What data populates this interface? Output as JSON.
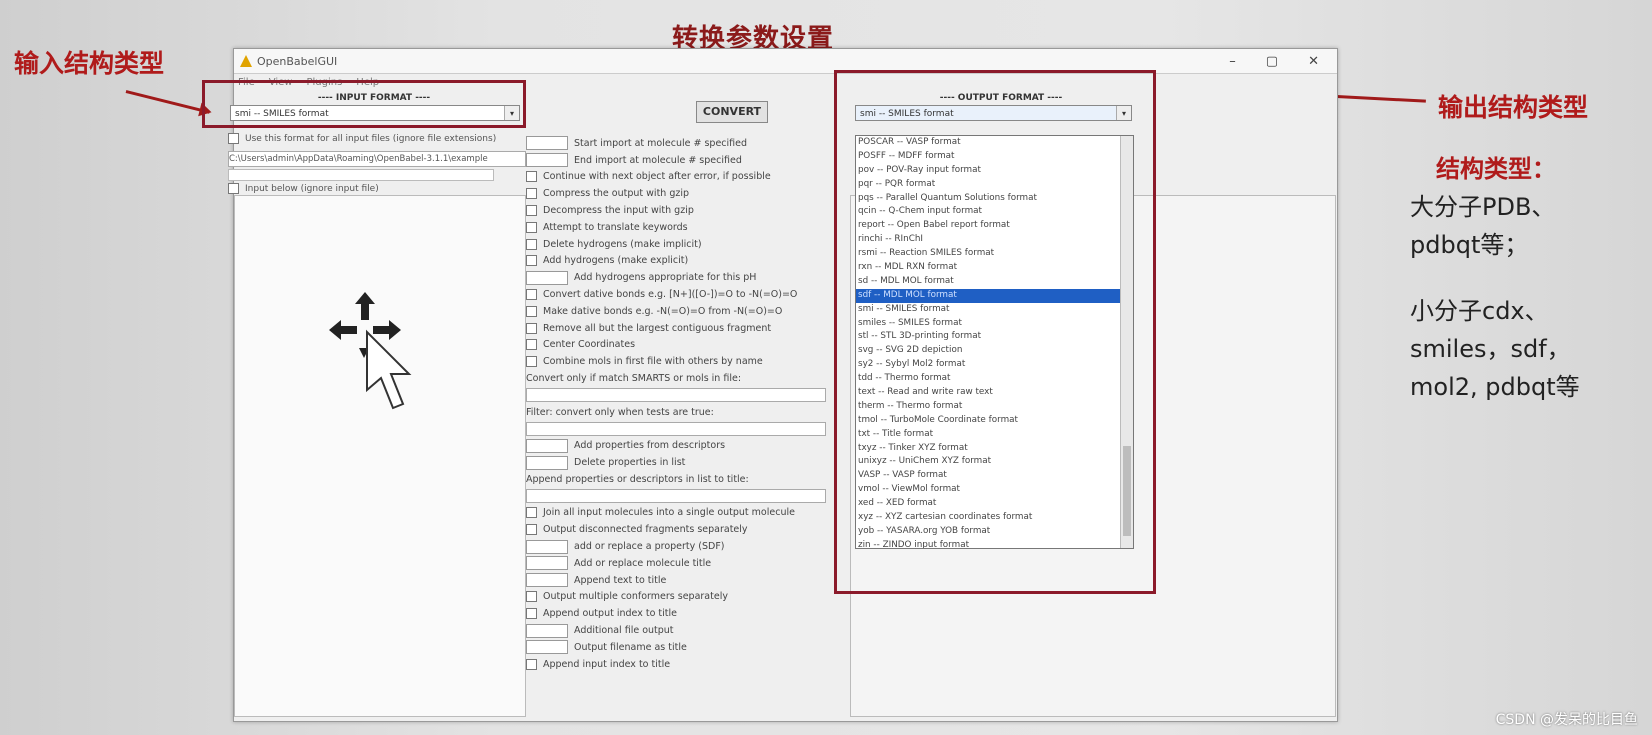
{
  "annotations": {
    "title": "转换参数设置",
    "input_label": "输入结构类型",
    "output_label": "输出结构类型",
    "note_heading": "结构类型：",
    "note_line1": "大分子PDB、",
    "note_line2": "pdbqt等；",
    "note_line3": "小分子cdx、",
    "note_line4": "smiles，sdf，",
    "note_line5": "mol2, pdbqt等"
  },
  "window": {
    "title": "OpenBabelGUI",
    "menu": [
      "File",
      "View",
      "Plugins",
      "Help"
    ],
    "minimize": "–",
    "maximize": "▢",
    "close": "✕"
  },
  "input": {
    "section_label": "---- INPUT FORMAT ----",
    "selected": "smi -- SMILES format",
    "use_format_all": "Use this format for all input files (ignore file extensions)",
    "file_path": "C:\\Users\\admin\\AppData\\Roaming\\OpenBabel-3.1.1\\example",
    "input_below": "Input below (ignore input file)"
  },
  "convert_label": "CONVERT",
  "options": [
    {
      "kind": "tb",
      "label": "Start import at molecule # specified"
    },
    {
      "kind": "tb",
      "label": "End import at molecule # specified"
    },
    {
      "kind": "cb",
      "label": "Continue with next object after error, if possible"
    },
    {
      "kind": "cb",
      "label": "Compress the output with gzip"
    },
    {
      "kind": "cb",
      "label": "Decompress the input with gzip"
    },
    {
      "kind": "cb",
      "label": "Attempt to translate keywords"
    },
    {
      "kind": "cb",
      "label": "Delete hydrogens (make implicit)"
    },
    {
      "kind": "cb",
      "label": "Add hydrogens (make explicit)"
    },
    {
      "kind": "tb",
      "label": "Add hydrogens appropriate for this pH"
    },
    {
      "kind": "cb",
      "label": "Convert dative bonds e.g. [N+]([O-])=O to -N(=O)=O"
    },
    {
      "kind": "cb",
      "label": "Make dative bonds e.g. -N(=O)=O from -N(=O)=O"
    },
    {
      "kind": "cb",
      "label": "Remove all but the largest contiguous fragment"
    },
    {
      "kind": "cb",
      "label": "Center Coordinates"
    },
    {
      "kind": "cb",
      "label": "Combine mols in first file with others by name"
    },
    {
      "kind": "txt",
      "label": "Convert only if match SMARTS or mols in file:"
    },
    {
      "kind": "wide",
      "label": ""
    },
    {
      "kind": "txt",
      "label": "Filter: convert only when tests are true:"
    },
    {
      "kind": "wide",
      "label": ""
    },
    {
      "kind": "tb",
      "label": "Add properties from descriptors"
    },
    {
      "kind": "tb",
      "label": "Delete properties in list"
    },
    {
      "kind": "txt",
      "label": "Append properties or descriptors in list to title:"
    },
    {
      "kind": "wide",
      "label": ""
    },
    {
      "kind": "cb",
      "label": "Join all input molecules into a single output molecule"
    },
    {
      "kind": "cb",
      "label": "Output disconnected fragments separately"
    },
    {
      "kind": "tb",
      "label": "add or replace a property (SDF)"
    },
    {
      "kind": "tb",
      "label": "Add or replace molecule title"
    },
    {
      "kind": "tb",
      "label": "Append text to title"
    },
    {
      "kind": "cb",
      "label": "Output multiple conformers separately"
    },
    {
      "kind": "cb",
      "label": "Append output index to title"
    },
    {
      "kind": "tb",
      "label": "Additional file output"
    },
    {
      "kind": "tb",
      "label": "Output filename as title"
    },
    {
      "kind": "cb",
      "label": "Append input index to title"
    }
  ],
  "output": {
    "section_label": "---- OUTPUT FORMAT ----",
    "selected": "smi -- SMILES format",
    "list": [
      "POSCAR -- VASP format",
      "POSFF -- MDFF format",
      "pov -- POV-Ray input format",
      "pqr -- PQR format",
      "pqs -- Parallel Quantum Solutions format",
      "qcin -- Q-Chem input format",
      "report -- Open Babel report format",
      "rinchi -- RInChI",
      "rsmi -- Reaction SMILES format",
      "rxn -- MDL RXN format",
      "sd -- MDL MOL format",
      "sdf -- MDL MOL format",
      "smi -- SMILES format",
      "smiles -- SMILES format",
      "stl -- STL 3D-printing format",
      "svg -- SVG 2D depiction",
      "sy2 -- Sybyl Mol2 format",
      "tdd -- Thermo format",
      "text -- Read and write raw text",
      "therm -- Thermo format",
      "tmol -- TurboMole Coordinate format",
      "txt -- Title format",
      "txyz -- Tinker XYZ format",
      "unixyz -- UniChem XYZ format",
      "VASP -- VASP format",
      "vmol -- ViewMol format",
      "xed -- XED format",
      "xyz -- XYZ cartesian coordinates format",
      "yob -- YASARA.org YOB format",
      "zin -- ZINDO input format"
    ],
    "selected_index": 11
  },
  "watermark": "CSDN @发呆的比目鱼"
}
